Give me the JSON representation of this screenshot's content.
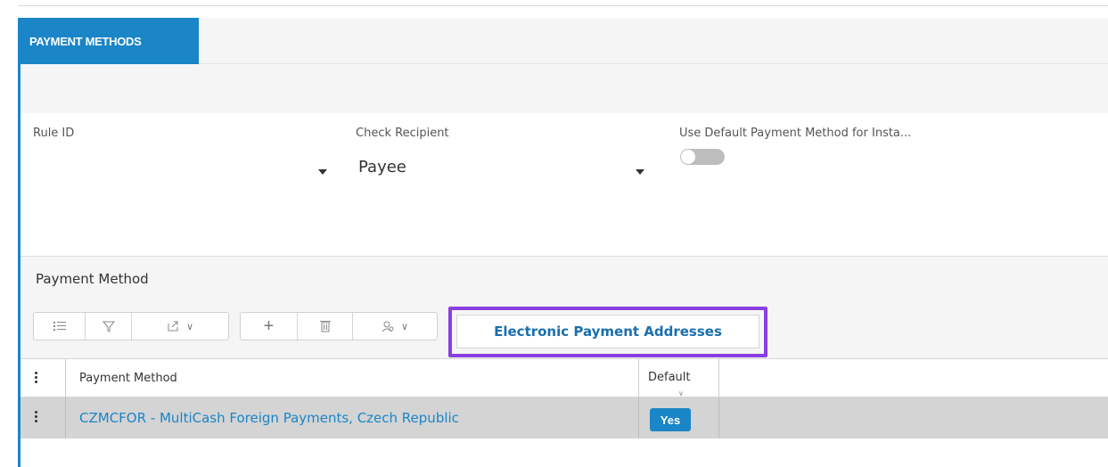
{
  "tabs": {
    "active_label": "PAYMENT METHODS"
  },
  "form": {
    "rule_id": {
      "label": "Rule ID",
      "value": ""
    },
    "check_recipient": {
      "label": "Check Recipient",
      "value": "Payee"
    },
    "use_default": {
      "label": "Use Default Payment Method for Insta...",
      "state": "off"
    }
  },
  "section": {
    "title": "Payment Method"
  },
  "toolbar": {
    "icons": [
      "list-icon",
      "filter-icon",
      "export-icon",
      "add-icon",
      "delete-icon",
      "settings-icon"
    ],
    "epa_button_label": "Electronic Payment Addresses"
  },
  "grid": {
    "columns": [
      "Payment Method",
      "Default"
    ],
    "rows": [
      {
        "payment_method": "CZMCFOR - MultiCash Foreign Payments, Czech Republic",
        "default": "Yes"
      }
    ]
  },
  "colors": {
    "accent": "#1a85c7",
    "highlight": "#8a3fe0"
  }
}
